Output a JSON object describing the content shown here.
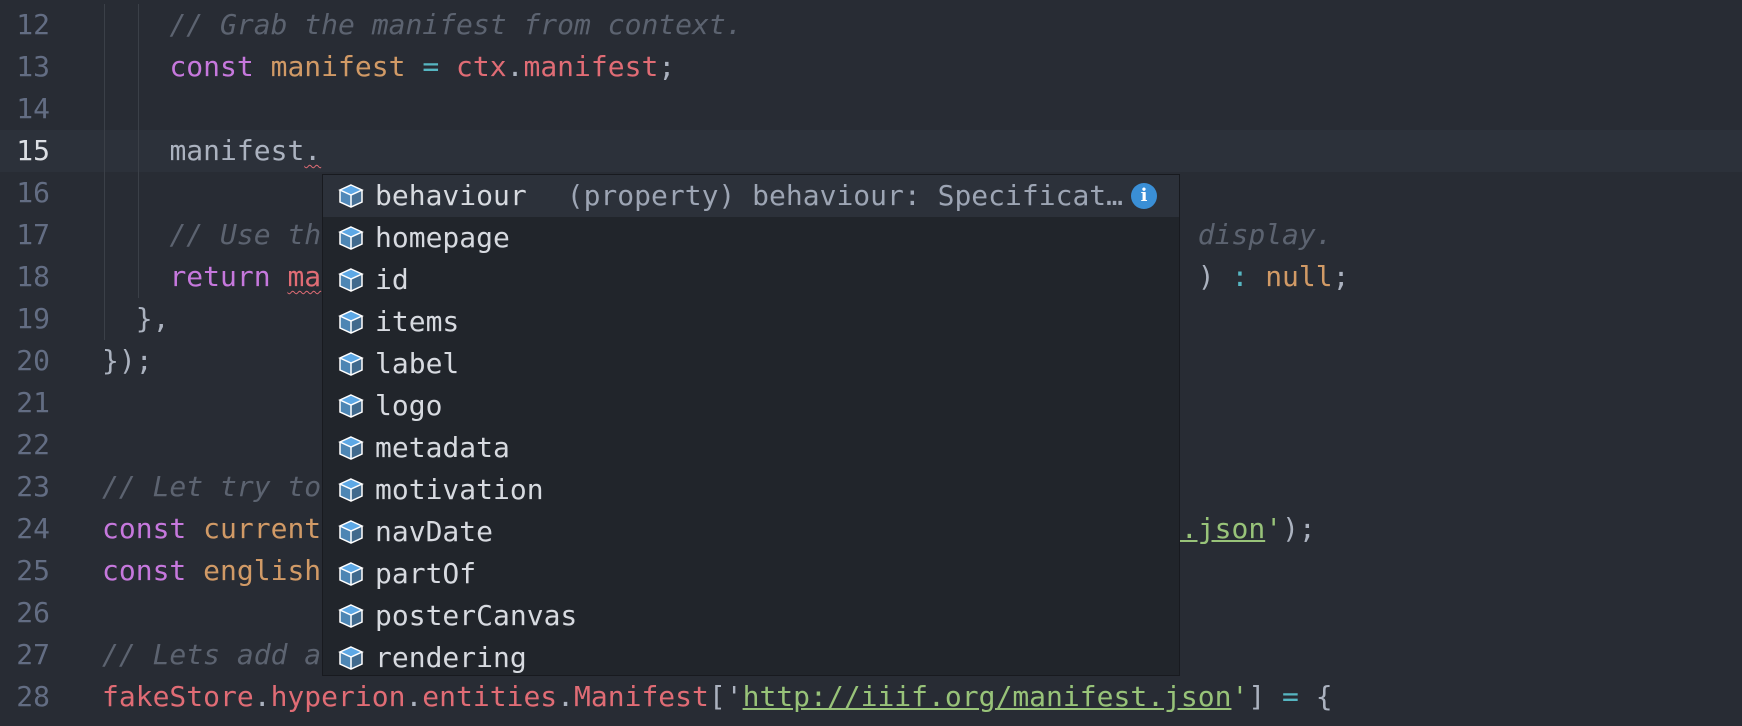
{
  "editor": {
    "current_line": 15,
    "lines": [
      {
        "n": "12",
        "tokens": [
          {
            "t": "// Grab the manifest from context.",
            "c": "t-cm"
          }
        ]
      },
      {
        "n": "13",
        "tokens": [
          {
            "t": "const",
            "c": "t-kw"
          },
          {
            "t": " ",
            "c": "t-pl"
          },
          {
            "t": "manifest",
            "c": "t-var2"
          },
          {
            "t": " ",
            "c": "t-pl"
          },
          {
            "t": "=",
            "c": "t-op"
          },
          {
            "t": " ",
            "c": "t-pl"
          },
          {
            "t": "ctx",
            "c": "t-prop"
          },
          {
            "t": ".",
            "c": "t-pl"
          },
          {
            "t": "manifest",
            "c": "t-prop"
          },
          {
            "t": ";",
            "c": "t-pl"
          }
        ]
      },
      {
        "n": "14",
        "tokens": []
      },
      {
        "n": "15",
        "tokens": [
          {
            "t": "manifest",
            "c": "t-pl"
          },
          {
            "t": ".",
            "c": "t-pl squiggle"
          }
        ]
      },
      {
        "n": "16",
        "tokens": []
      },
      {
        "n": "17",
        "tokens": [
          {
            "t": "// Use th",
            "c": "t-cm"
          },
          {
            "t": "                                                    display.",
            "c": "t-cm"
          }
        ]
      },
      {
        "n": "18",
        "tokens": [
          {
            "t": "return",
            "c": "t-kw"
          },
          {
            "t": " ",
            "c": "t-pl"
          },
          {
            "t": "ma",
            "c": "t-prop squiggle"
          },
          {
            "t": "                                                    ) ",
            "c": "t-pl"
          },
          {
            "t": ":",
            "c": "t-op"
          },
          {
            "t": " ",
            "c": "t-pl"
          },
          {
            "t": "null",
            "c": "t-null"
          },
          {
            "t": ";",
            "c": "t-pl"
          }
        ]
      },
      {
        "n": "19",
        "tokens": [
          {
            "t": "},",
            "c": "t-pl"
          }
        ]
      },
      {
        "n": "20",
        "tokens": [
          {
            "t": "});",
            "c": "t-pl"
          }
        ]
      },
      {
        "n": "21",
        "tokens": []
      },
      {
        "n": "22",
        "tokens": []
      },
      {
        "n": "23",
        "tokens": [
          {
            "t": "// Let try to",
            "c": "t-cm"
          }
        ]
      },
      {
        "n": "24",
        "tokens": [
          {
            "t": "const",
            "c": "t-kw"
          },
          {
            "t": " ",
            "c": "t-pl"
          },
          {
            "t": "current",
            "c": "t-var2"
          },
          {
            "t": "                                                  ",
            "c": "t-pl"
          },
          {
            "t": "t.json",
            "c": "t-strl"
          },
          {
            "t": "'",
            "c": "t-str"
          },
          {
            "t": ");",
            "c": "t-pl"
          }
        ]
      },
      {
        "n": "25",
        "tokens": [
          {
            "t": "const",
            "c": "t-kw"
          },
          {
            "t": " ",
            "c": "t-pl"
          },
          {
            "t": "english",
            "c": "t-var2"
          }
        ]
      },
      {
        "n": "26",
        "tokens": []
      },
      {
        "n": "27",
        "tokens": [
          {
            "t": "// Lets add a",
            "c": "t-cm"
          }
        ]
      },
      {
        "n": "28",
        "tokens": [
          {
            "t": "fakeStore",
            "c": "t-prop"
          },
          {
            "t": ".",
            "c": "t-pl"
          },
          {
            "t": "hyperion",
            "c": "t-prop"
          },
          {
            "t": ".",
            "c": "t-pl"
          },
          {
            "t": "entities",
            "c": "t-prop"
          },
          {
            "t": ".",
            "c": "t-pl"
          },
          {
            "t": "Manifest",
            "c": "t-prop"
          },
          {
            "t": "['",
            "c": "t-pl"
          },
          {
            "t": "http://iiif.org/manifest.json",
            "c": "t-strl"
          },
          {
            "t": "'",
            "c": "t-str"
          },
          {
            "t": "] ",
            "c": "t-pl"
          },
          {
            "t": "=",
            "c": "t-op"
          },
          {
            "t": " {",
            "c": "t-pl"
          }
        ]
      }
    ],
    "indents": [
      2,
      2,
      2,
      2,
      2,
      2,
      2,
      1,
      0,
      0,
      0,
      0,
      0,
      0,
      0,
      0,
      0
    ]
  },
  "autocomplete": {
    "icon": "property-cube-icon",
    "icon_color": "#61afef",
    "selected_index": 0,
    "items": [
      {
        "label": "behaviour",
        "detail": "(property) behaviour: Specificat…",
        "info": "i"
      },
      {
        "label": "homepage"
      },
      {
        "label": "id"
      },
      {
        "label": "items"
      },
      {
        "label": "label"
      },
      {
        "label": "logo"
      },
      {
        "label": "metadata"
      },
      {
        "label": "motivation"
      },
      {
        "label": "navDate"
      },
      {
        "label": "partOf"
      },
      {
        "label": "posterCanvas"
      },
      {
        "label": "rendering"
      }
    ]
  }
}
